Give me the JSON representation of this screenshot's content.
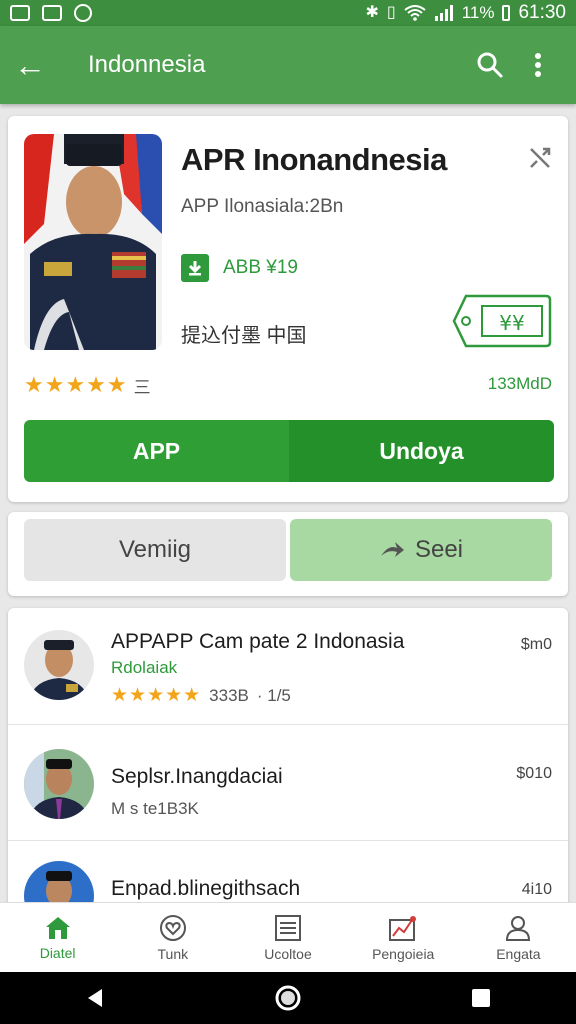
{
  "status_bar": {
    "battery": "11%",
    "time": "61:30"
  },
  "app_bar": {
    "title": "Indonnesia"
  },
  "app": {
    "title": "APR Inonandnesia",
    "subtitle": "APP Ilonasiala:2Bn",
    "download_text": "ABB ¥19",
    "chinese_text": "提込付墨 中国",
    "tag_text": "¥¥",
    "size": "133MdD",
    "rating_count": "三",
    "stars_full": 4,
    "stars_half": 1
  },
  "buttons": {
    "primary_left": "APP",
    "primary_right": "Undoya",
    "secondary_left": "Vemiig",
    "secondary_right": "Seei"
  },
  "list": {
    "items": [
      {
        "name": "APPAPP Cam pate 2 Indonasia",
        "developer": "Rdolaiak",
        "rating_value": "333B",
        "extra": "· 1/5",
        "price": "$m0"
      },
      {
        "name": "Seplsr.Inangdaciai",
        "meta": "M s te1B3K",
        "price": "$010"
      },
      {
        "name": "Enpad.blinegithsach",
        "price": "4i10"
      }
    ]
  },
  "bottom_nav": {
    "items": [
      "Diatel",
      "Tunk",
      "Ucoltoe",
      "Pengoieia",
      "Engata"
    ]
  },
  "colors": {
    "primary": "#4e9f50",
    "accent": "#2e9a3b",
    "star": "#f2a51b"
  }
}
